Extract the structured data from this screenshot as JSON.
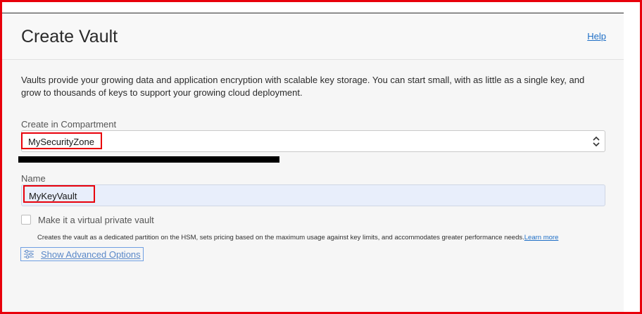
{
  "header": {
    "title": "Create Vault",
    "help_label": "Help"
  },
  "description": "Vaults provide your growing data and application encryption with scalable key storage. You can start small, with as little as a single key, and grow to thousands of keys to support your growing cloud deployment.",
  "compartment": {
    "label": "Create in Compartment",
    "selected": "MySecurityZone"
  },
  "name_field": {
    "label": "Name",
    "value": "MyKeyVault"
  },
  "virtual_private": {
    "label": "Make it a virtual private vault",
    "checked": false,
    "help_text": "Creates the vault as a dedicated partition on the HSM, sets pricing based on the maximum usage against key limits, and accommodates greater performance needs.",
    "learn_more_label": "Learn more"
  },
  "advanced": {
    "label": "Show Advanced Options",
    "icon": "sliders-icon"
  },
  "colors": {
    "annotation": "#e8000b",
    "link": "#1f6fc6",
    "input_fill": "#e8eefb"
  }
}
